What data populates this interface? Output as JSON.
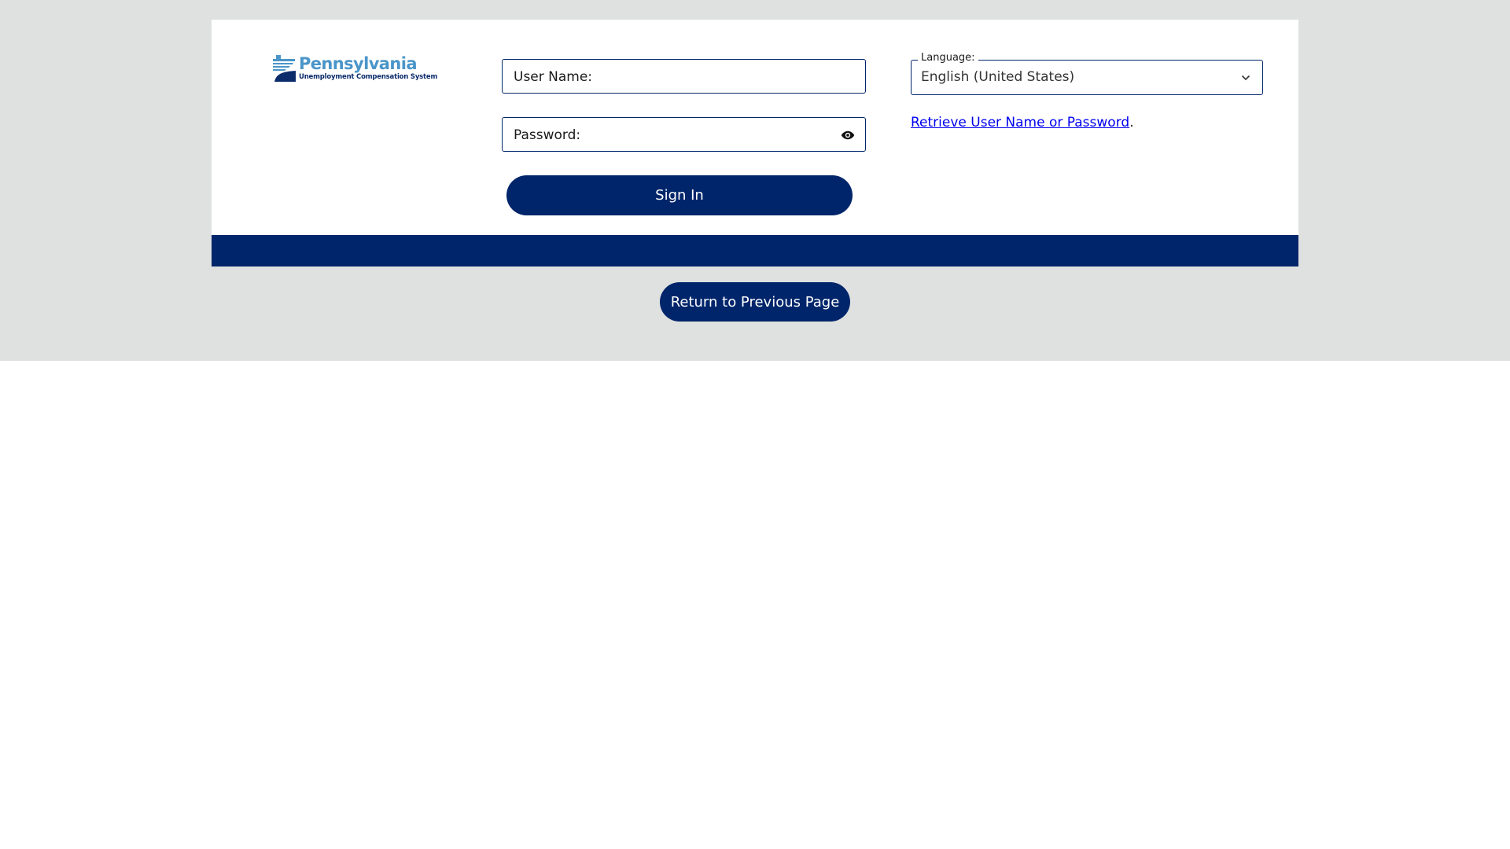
{
  "logo": {
    "title": "Pennsylvania",
    "subtitle": "Unemployment Compensation System",
    "icon": "pa-keystone-logo-icon"
  },
  "login": {
    "username_label": "User Name:",
    "username_value": "",
    "password_label": "Password:",
    "password_value": "",
    "show_password_icon": "eye-icon",
    "signin_label": "Sign In"
  },
  "language": {
    "label": "Language:",
    "selected": "English (United States)",
    "icon": "chevron-down-icon"
  },
  "retrieve": {
    "link_text": "Retrieve User Name or Password",
    "suffix": "."
  },
  "return_button": {
    "label": "Return to Previous Page"
  },
  "colors": {
    "brand_navy": "#00256a",
    "logo_blue": "#4a95c9",
    "page_grey": "#dfe0e0",
    "link": "#0000ee"
  }
}
